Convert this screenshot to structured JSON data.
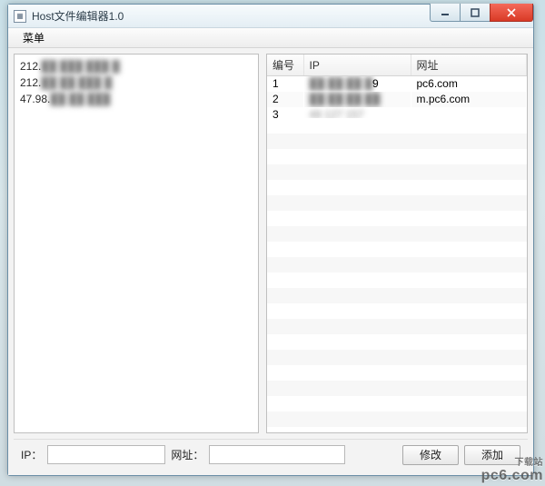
{
  "window": {
    "title": "Host文件编辑器1.0"
  },
  "menubar": {
    "menu": "菜单"
  },
  "left_list": {
    "items": [
      {
        "prefix": "212.",
        "rest": "██ ███ ███ █"
      },
      {
        "prefix": "212.",
        "rest": "██ ██ ███ █"
      },
      {
        "prefix": "47.98.",
        "rest": "██ ██ ███"
      }
    ]
  },
  "table": {
    "headers": {
      "num": "编号",
      "ip": "IP",
      "url": "网址"
    },
    "rows": [
      {
        "num": "1",
        "ip_blur": "██ ██ ██ █",
        "ip_tail": "9",
        "url": "pc6.com"
      },
      {
        "num": "2",
        "ip_blur": "██ ██ ██ ██",
        "ip_tail": "",
        "url": "m.pc6.com"
      },
      {
        "num": "3",
        "ip_blur": "48 127 157",
        "ip_tail": "",
        "url": ""
      }
    ]
  },
  "bottom": {
    "ip_label": "IP：",
    "url_label": "网址：",
    "ip_value": "",
    "url_value": "",
    "modify": "修改",
    "add": "添加"
  },
  "watermark": {
    "pre": "下载站",
    "brand": "pc6.com"
  }
}
